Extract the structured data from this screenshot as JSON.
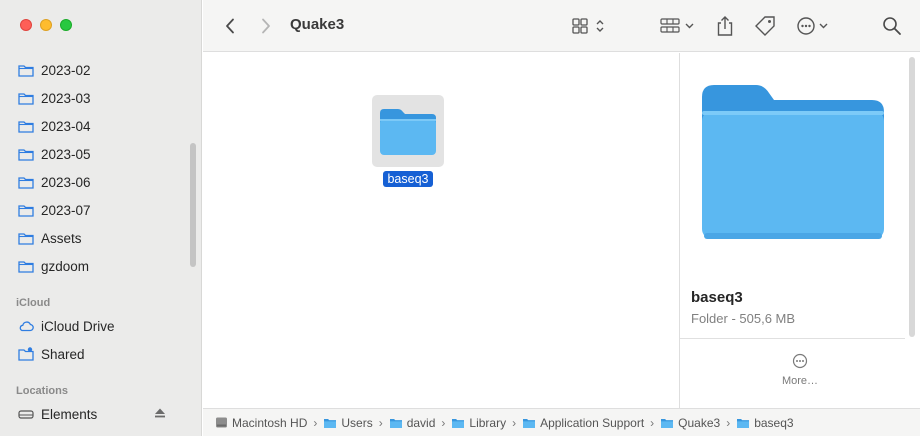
{
  "window": {
    "title": "Quake3"
  },
  "colors": {
    "accent": "#1660d4",
    "folder": "#5cb8f2"
  },
  "sidebar": {
    "favorites": [
      {
        "label": "2023-02",
        "icon": "folder-icon"
      },
      {
        "label": "2023-03",
        "icon": "folder-icon"
      },
      {
        "label": "2023-04",
        "icon": "folder-icon"
      },
      {
        "label": "2023-05",
        "icon": "folder-icon"
      },
      {
        "label": "2023-06",
        "icon": "folder-icon"
      },
      {
        "label": "2023-07",
        "icon": "folder-icon"
      },
      {
        "label": "Assets",
        "icon": "folder-icon"
      },
      {
        "label": "gzdoom",
        "icon": "folder-icon"
      }
    ],
    "icloud": {
      "header": "iCloud",
      "items": [
        {
          "label": "iCloud Drive",
          "icon": "cloud-icon"
        },
        {
          "label": "Shared",
          "icon": "shared-folder-icon"
        }
      ]
    },
    "locations": {
      "header": "Locations",
      "items": [
        {
          "label": "Elements",
          "icon": "drive-icon"
        }
      ]
    }
  },
  "content": {
    "items": [
      {
        "name": "baseq3",
        "selected": true
      }
    ]
  },
  "preview": {
    "name": "baseq3",
    "subtitle": "Folder - 505,6 MB",
    "more_label": "More…"
  },
  "pathbar": {
    "crumbs": [
      "Macintosh HD",
      "Users",
      "david",
      "Library",
      "Application Support",
      "Quake3",
      "baseq3"
    ],
    "separator": "›"
  }
}
